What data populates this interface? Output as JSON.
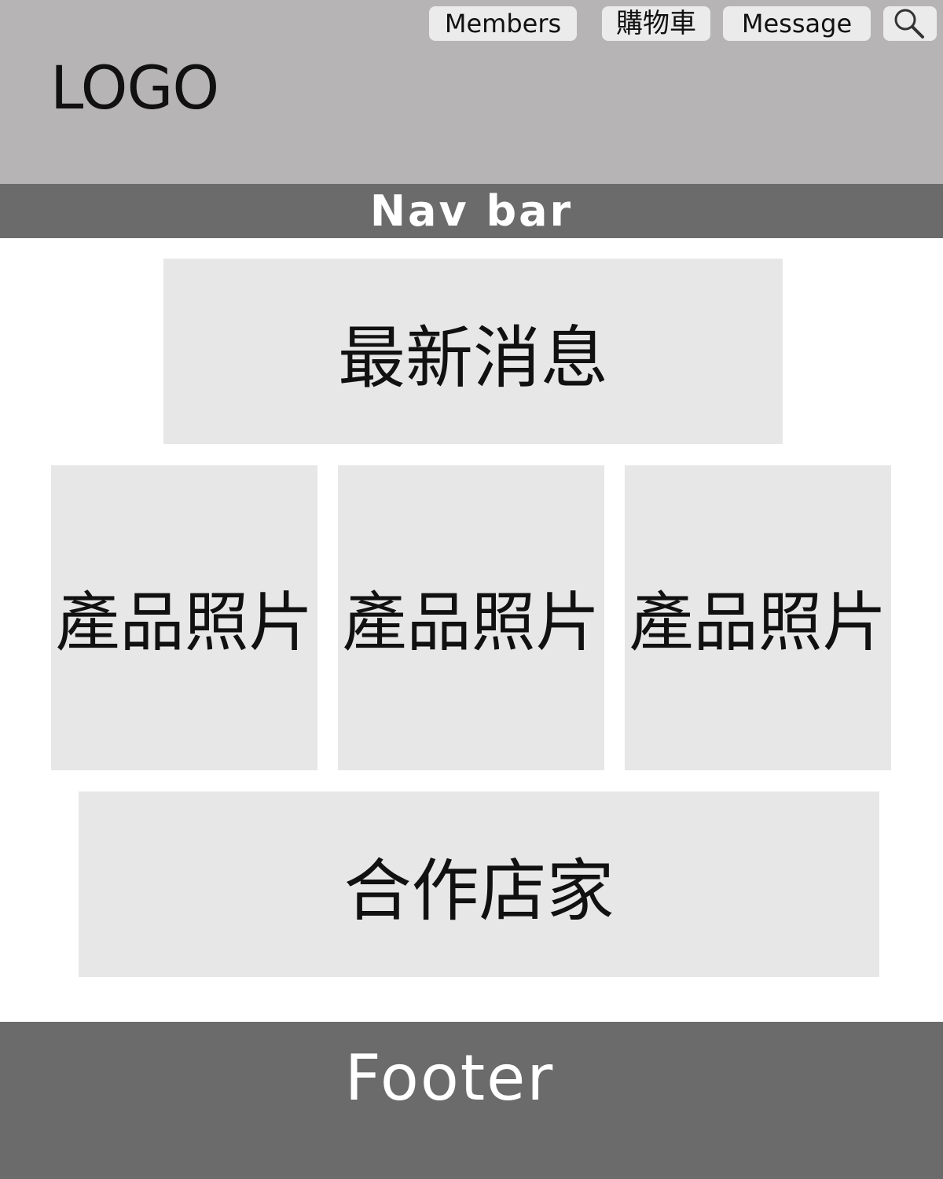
{
  "header": {
    "logo": "LOGO",
    "buttons": {
      "members": "Members",
      "cart": "購物車",
      "message": "Message"
    },
    "search_icon": "search-icon"
  },
  "nav": {
    "label": "Nav bar"
  },
  "main": {
    "news": "最新消息",
    "product_photos": [
      "產品照片",
      "產品照片",
      "產品照片"
    ],
    "partners": "合作店家"
  },
  "footer": {
    "label": "Footer"
  },
  "colors": {
    "header_bg": "#b7b4b5",
    "bar_bg": "#6b6b6b",
    "box_bg": "#e7e7e7",
    "button_bg": "#ebebeb"
  }
}
